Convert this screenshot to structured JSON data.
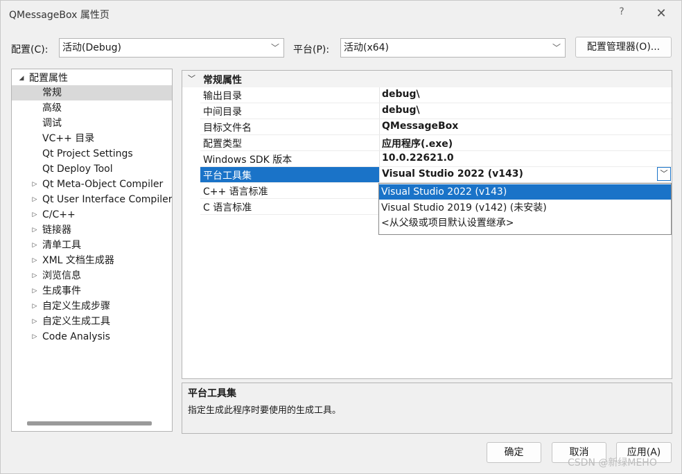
{
  "window": {
    "title": "QMessageBox 属性页",
    "help": "?",
    "close": "✕"
  },
  "toolbar": {
    "config_label": "配置(C):",
    "config_value": "活动(Debug)",
    "platform_label": "平台(P):",
    "platform_value": "活动(x64)",
    "config_manager": "配置管理器(O)..."
  },
  "tree": {
    "items": [
      {
        "label": "配置属性",
        "arrow": "◢"
      },
      {
        "label": "常规"
      },
      {
        "label": "高级"
      },
      {
        "label": "调试"
      },
      {
        "label": "VC++ 目录"
      },
      {
        "label": "Qt Project Settings"
      },
      {
        "label": "Qt Deploy Tool"
      },
      {
        "label": "Qt Meta-Object Compiler",
        "arrow": "▷"
      },
      {
        "label": "Qt User Interface Compiler",
        "arrow": "▷"
      },
      {
        "label": "C/C++",
        "arrow": "▷"
      },
      {
        "label": "链接器",
        "arrow": "▷"
      },
      {
        "label": "清单工具",
        "arrow": "▷"
      },
      {
        "label": "XML 文档生成器",
        "arrow": "▷"
      },
      {
        "label": "浏览信息",
        "arrow": "▷"
      },
      {
        "label": "生成事件",
        "arrow": "▷"
      },
      {
        "label": "自定义生成步骤",
        "arrow": "▷"
      },
      {
        "label": "自定义生成工具",
        "arrow": "▷"
      },
      {
        "label": "Code Analysis",
        "arrow": "▷"
      }
    ]
  },
  "grid": {
    "category": "常规属性",
    "rows": [
      {
        "name": "输出目录",
        "value": "debug\\"
      },
      {
        "name": "中间目录",
        "value": "debug\\"
      },
      {
        "name": "目标文件名",
        "value": "QMessageBox"
      },
      {
        "name": "配置类型",
        "value": "应用程序(.exe)"
      },
      {
        "name": "Windows SDK 版本",
        "value": "10.0.22621.0"
      },
      {
        "name": "平台工具集",
        "value": "Visual Studio 2022 (v143)"
      },
      {
        "name": "C++ 语言标准",
        "value": ""
      },
      {
        "name": "C 语言标准",
        "value": ""
      }
    ]
  },
  "dropdown": {
    "options": [
      "Visual Studio 2022 (v143)",
      "Visual Studio 2019 (v142) (未安装)",
      "<从父级或项目默认设置继承>"
    ]
  },
  "description": {
    "title": "平台工具集",
    "text": "指定生成此程序时要使用的生成工具。"
  },
  "buttons": {
    "ok": "确定",
    "cancel": "取消",
    "apply": "应用(A)"
  },
  "watermark": "CSDN @新绿MEHO",
  "colors": {
    "accent": "#1a73c8",
    "selected_tree": "#d9d9d9"
  }
}
